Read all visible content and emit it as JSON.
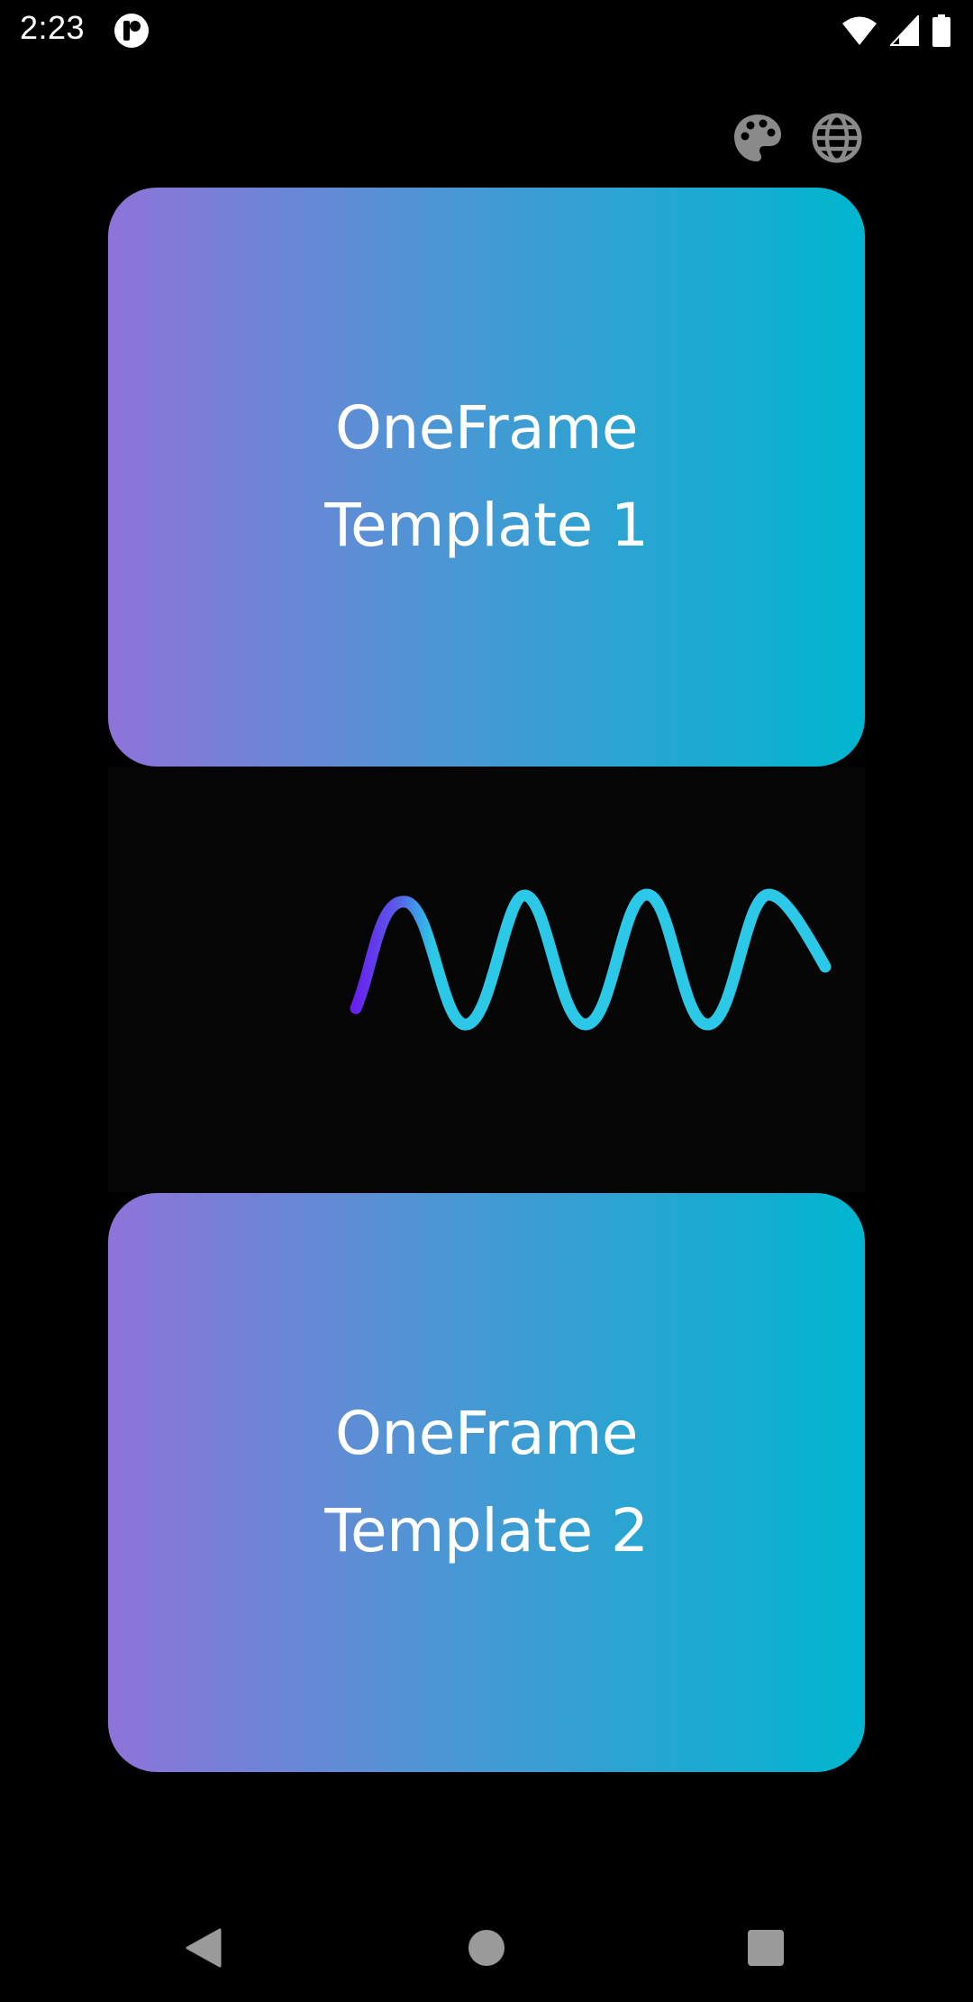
{
  "status_bar": {
    "time": "2:23",
    "app_icon": "notification-app-icon",
    "wifi_icon": "wifi-icon",
    "signal_icon": "cell-signal-icon",
    "battery_icon": "battery-icon"
  },
  "actions": {
    "theme_icon": "palette-icon",
    "language_icon": "globe-icon",
    "icon_color": "#8a8a8a"
  },
  "cards": [
    {
      "line1": "OneFrame",
      "line2": "Template 1"
    },
    {
      "line1": "OneFrame",
      "line2": "Template 2"
    }
  ],
  "colors": {
    "background": "#000000",
    "card_gradient_start": "#8e73d8",
    "card_gradient_end": "#00b6ce",
    "wave_start": "#6a1cf0",
    "wave_end": "#2bc8e8",
    "wave_panel": "#050505"
  },
  "nav_bar": {
    "back_icon": "back-triangle-icon",
    "home_icon": "home-circle-icon",
    "recents_icon": "recents-square-icon",
    "icon_color": "#9a9a9a"
  }
}
